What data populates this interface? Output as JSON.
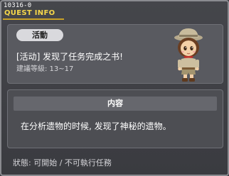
{
  "header": {
    "quest_id": "10316-0",
    "title": "QUEST INFO"
  },
  "quest": {
    "category": "活動",
    "name": "[活动] 发现了任务完成之书!",
    "level_range": "建議等級: 13~17"
  },
  "content": {
    "section_label": "内容",
    "description": "在分析遗物的时候, 发现了神秘的遗物。"
  },
  "status": {
    "text": "狀態: 可開始 / 不可執行任務"
  },
  "npc": {
    "icon": "explorer-girl-npc-portrait"
  },
  "colors": {
    "title": "#f7d84a",
    "title_underline": "#c9a227",
    "window_background": "#3b3c41",
    "panel_background": "#595a60",
    "badge_background": "#d9d9dd"
  }
}
